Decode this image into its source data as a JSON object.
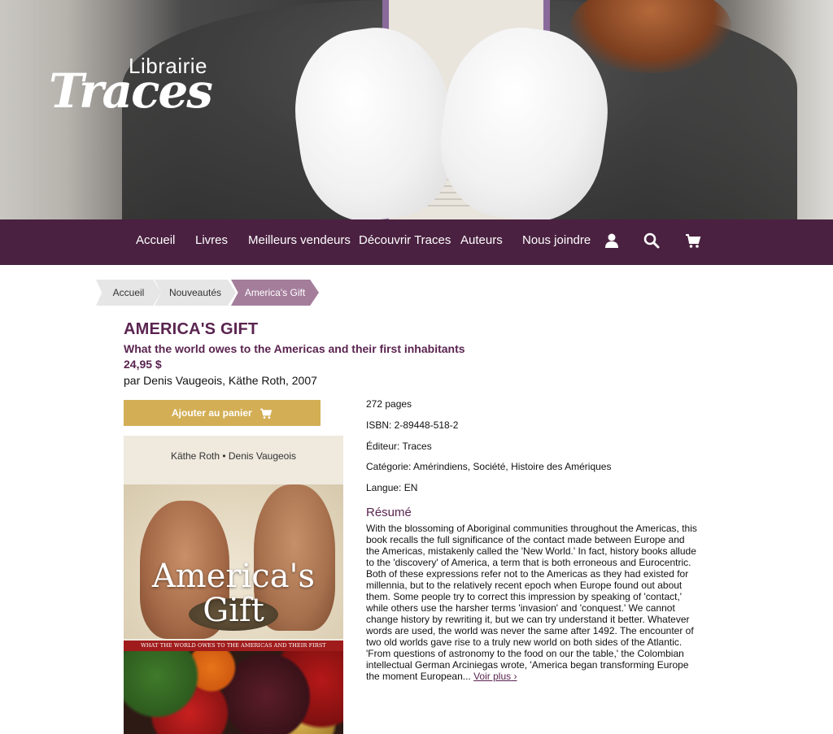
{
  "brand": {
    "small": "Librairie",
    "big": "Traces"
  },
  "nav": {
    "items": [
      "Accueil",
      "Livres",
      "Meilleurs vendeurs",
      "Découvrir Traces",
      "Auteurs",
      "Nous joindre"
    ],
    "icons": [
      "user-icon",
      "search-icon",
      "cart-icon"
    ]
  },
  "breadcrumb": [
    "Accueil",
    "Nouveautés",
    "America's Gift"
  ],
  "book": {
    "title": "AMERICA'S GIFT",
    "subtitle": "What the world owes to the Americas and their first inhabitants",
    "price": "24,95 $",
    "byline": "par Denis Vaugeois, Käthe Roth, 2007",
    "add_to_cart": "Ajouter au panier",
    "cover": {
      "authors": "Käthe Roth • Denis Vaugeois",
      "title_line1": "America's",
      "title_line2": "Gift",
      "band": "WHAT THE WORLD OWES TO THE AMERICAS AND THEIR FIRST INHABITANTS"
    },
    "pages": "272 pages",
    "isbn": "ISBN: 2-89448-518-2",
    "publisher": "Éditeur: Traces",
    "category": "Catégorie: Amérindiens, Société, Histoire des Amériques",
    "language": "Langue: EN",
    "resume_heading": "Résumé",
    "resume": "With the blossoming of Aboriginal communities throughout the Americas, this book recalls the full significance of the contact made between Europe and the Americas, mistakenly called the 'New World.' In fact, history books allude to the 'discovery' of America, a term that is both erroneous and Eurocentric. Both of these expressions refer not to the Americas as they had existed for millennia, but to the relatively recent epoch when Europe found out about them. Some people try to correct this impression by speaking of 'contact,' while others use the harsher terms 'invasion' and 'conquest.' We cannot change history by rewriting it, but we can try understand it better. Whatever words are used, the world was never the same after 1492. The encounter of two old worlds gave rise to a truly new world on both sides of the Atlantic. 'From questions of astronomy to the food on our the table,' the Colombian intellectual German Arciniegas wrote, 'America began transforming Europe the moment European...",
    "more": "Voir plus"
  },
  "colors": {
    "nav_bg": "#4a2140",
    "accent": "#5a2450",
    "button": "#d3ae55",
    "crumb_active": "#a47d9b"
  }
}
